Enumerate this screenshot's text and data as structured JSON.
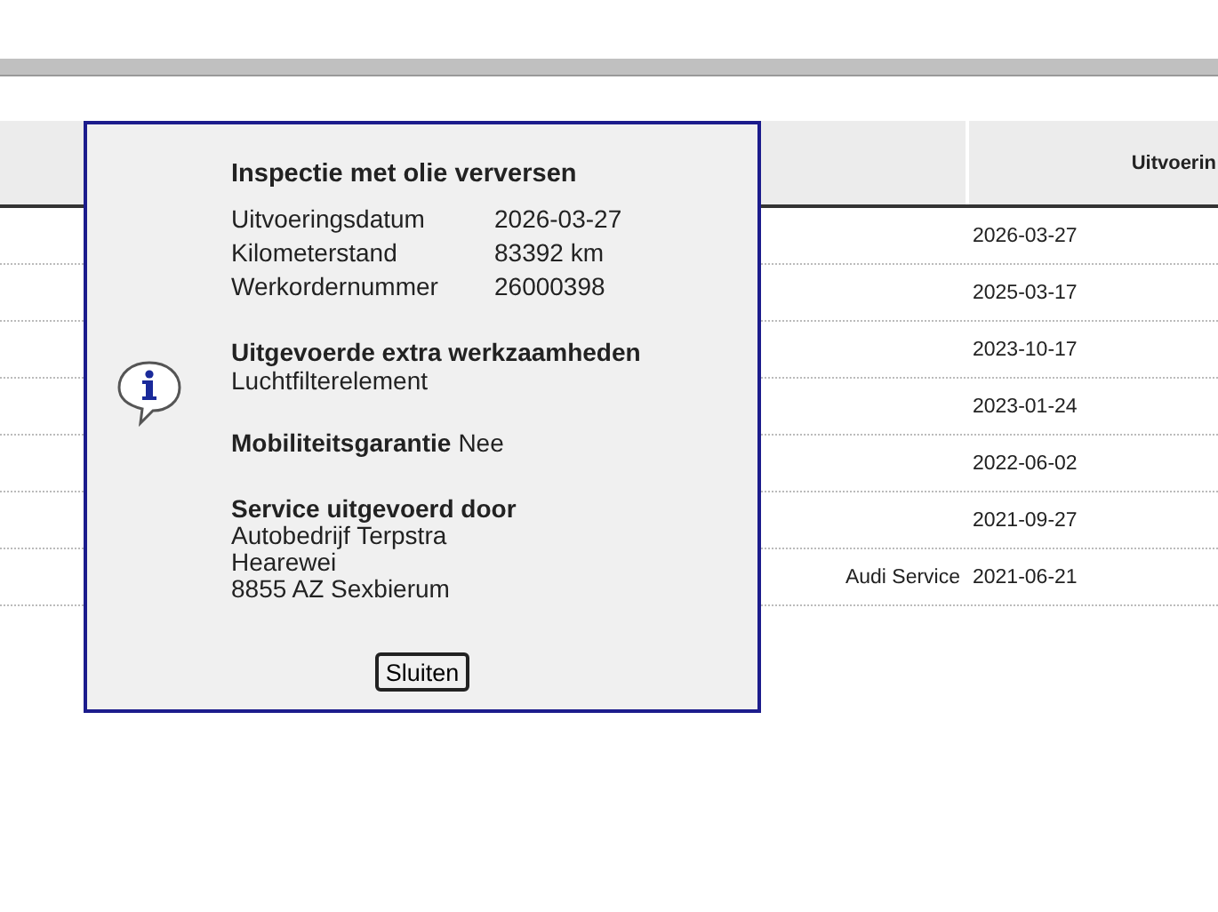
{
  "table": {
    "header": {
      "column_3": "Uitvoerin"
    },
    "rows": [
      {
        "date": "2026-03-27"
      },
      {
        "date": "2025-03-17"
      },
      {
        "date": "2023-10-17"
      },
      {
        "date": "2023-01-24"
      },
      {
        "date": "2022-06-02"
      },
      {
        "date": "2021-09-27"
      },
      {
        "column_2": "Audi Service",
        "date": "2021-06-21"
      }
    ]
  },
  "dialog": {
    "title": "Inspectie met olie verversen",
    "fields": [
      {
        "label": "Uitvoeringsdatum",
        "value": "2026-03-27"
      },
      {
        "label": "Kilometerstand",
        "value": "83392 km"
      },
      {
        "label": "Werkordernummer",
        "value": "26000398"
      }
    ],
    "extra_work": {
      "heading": "Uitgevoerde extra werkzaamheden",
      "text": "Luchtfilterelement"
    },
    "mobility": {
      "label": "Mobiliteitsgarantie",
      "value": "Nee"
    },
    "service": {
      "heading": "Service uitgevoerd door",
      "lines": [
        "Autobedrijf Terpstra",
        "Hearewei",
        "8855 AZ Sexbierum"
      ]
    },
    "button": "Sluiten"
  }
}
